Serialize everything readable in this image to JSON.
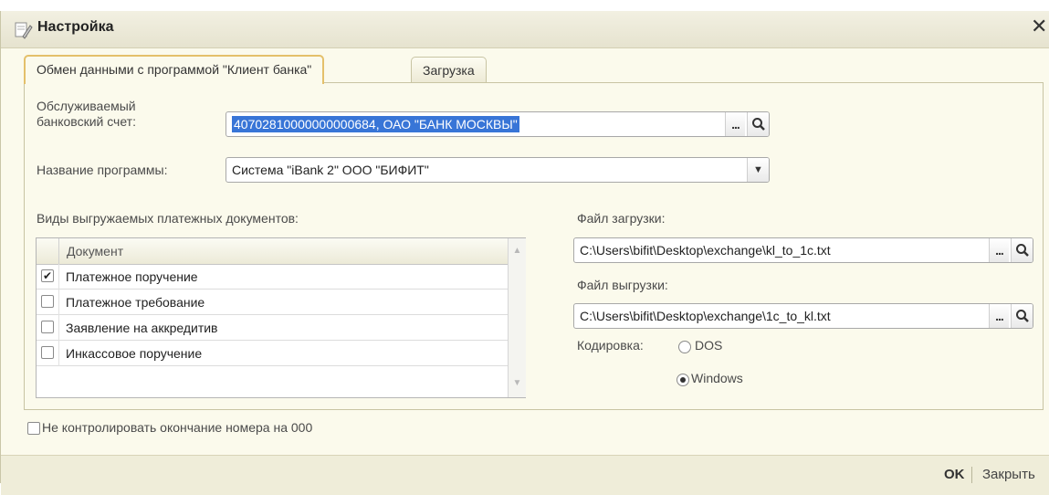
{
  "window": {
    "title": "Настройка"
  },
  "tabs": [
    {
      "label": "Обмен данными с программой \"Клиент банка\""
    },
    {
      "label": "Загрузка"
    }
  ],
  "account": {
    "label_line1": "Обслуживаемый",
    "label_line2": "банковский счет:",
    "value": "40702810000000000684, ОАО \"БАНК МОСКВЫ\""
  },
  "program": {
    "label": "Название программы:",
    "value": "Система \"iBank 2\" ООО \"БИФИТ\""
  },
  "documents": {
    "label": "Виды выгружаемых платежных документов:",
    "column_header": "Документ",
    "rows": [
      {
        "label": "Платежное поручение",
        "checked": true
      },
      {
        "label": "Платежное требование",
        "checked": false
      },
      {
        "label": "Заявление на аккредитив",
        "checked": false
      },
      {
        "label": "Инкассовое поручение",
        "checked": false
      }
    ]
  },
  "import_file": {
    "label": "Файл загрузки:",
    "value": "C:\\Users\\bifit\\Desktop\\exchange\\kl_to_1c.txt"
  },
  "export_file": {
    "label": "Файл выгрузки:",
    "value": "C:\\Users\\bifit\\Desktop\\exchange\\1c_to_kl.txt"
  },
  "encoding": {
    "label": "Кодировка:",
    "options": [
      {
        "label": "DOS",
        "selected": false
      },
      {
        "label": "Windows",
        "selected": true
      }
    ]
  },
  "no_control": {
    "label": "Не контролировать окончание номера на 000",
    "checked": false
  },
  "footer": {
    "ok_label": "OK",
    "close_label": "Закрыть"
  },
  "buttons": {
    "ellipsis": "..."
  },
  "glyphs": {
    "check": "✔",
    "close": "✕",
    "dropdown": "▼",
    "scroll_up": "▲",
    "scroll_down": "▼"
  },
  "colors": {
    "accent_tab_border": "#e4c06a",
    "selection": "#3875d7",
    "background": "#fbfaec"
  }
}
